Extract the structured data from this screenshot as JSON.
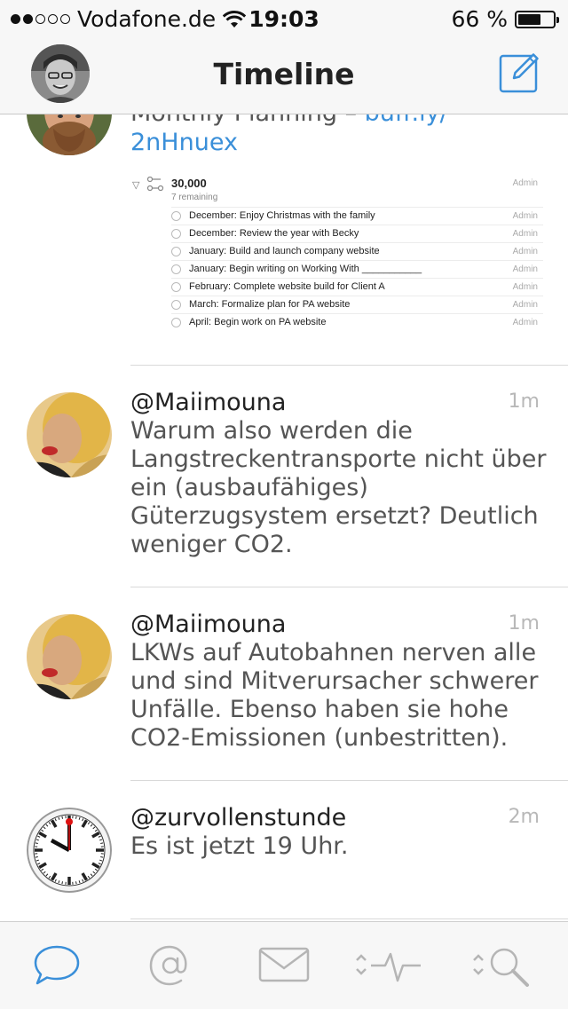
{
  "status_bar": {
    "carrier": "Vodafone.de",
    "time": "19:03",
    "battery": "66 %",
    "battery_level": 0.66,
    "signal_bars": 2
  },
  "nav": {
    "title": "Timeline",
    "compose_icon": "compose-icon"
  },
  "posts": [
    {
      "text_partial": "Monthly Planning",
      "link_partial": "buff.ly/",
      "link_cont": "2nHnuex",
      "embed": {
        "title": "30,000",
        "subtitle": "7 remaining",
        "admin": "Admin",
        "items": [
          "December: Enjoy Christmas with the family",
          "December: Review the year with Becky",
          "January: Build and launch company website",
          "January: Begin writing on Working With ___________",
          "February: Complete website build for Client A",
          "March: Formalize plan for PA website",
          "April: Begin work on PA website"
        ]
      }
    },
    {
      "username": "@Maiimouna",
      "time": "1m",
      "lines": [
        "Warum also werden die",
        "Langstreckentransporte nicht über",
        "ein (ausbaufähiges)",
        "Güterzugsystem ersetzt? Deutlich",
        "weniger CO2."
      ]
    },
    {
      "username": "@Maiimouna",
      "time": "1m",
      "lines": [
        "LKWs auf Autobahnen nerven alle",
        "und sind Mitverursacher schwerer",
        "Unfälle. Ebenso haben sie hohe",
        "CO2-Emissionen (unbestritten)."
      ]
    },
    {
      "username": "@zurvollenstunde",
      "time": "2m",
      "lines": [
        "Es ist jetzt 19 Uhr."
      ]
    }
  ],
  "tabs": [
    "chat-bubble-icon",
    "mention-icon",
    "mail-icon",
    "activity-icon",
    "search-icon"
  ],
  "colors": {
    "accent": "#3a8fd9",
    "tab_inactive": "#b5b5b5"
  }
}
